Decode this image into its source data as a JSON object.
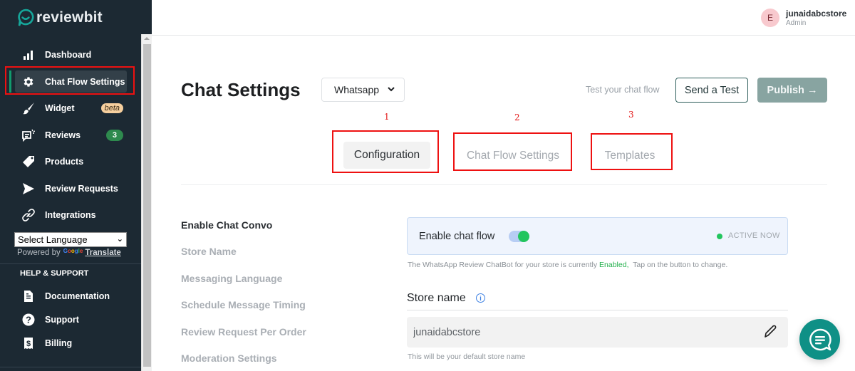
{
  "brand": {
    "name": "reviewbit",
    "accent": "#119b6d",
    "logo_color": "#16a79b"
  },
  "sidebar": {
    "items": [
      {
        "label": "Dashboard",
        "icon": "bar-chart-icon"
      },
      {
        "label": "Chat Flow Settings",
        "icon": "gear-icon",
        "active": true
      },
      {
        "label": "Widget",
        "icon": "brush-icon",
        "badge": "beta"
      },
      {
        "label": "Reviews",
        "icon": "reviews-icon",
        "badge": "3"
      },
      {
        "label": "Products",
        "icon": "tag-icon"
      },
      {
        "label": "Review Requests",
        "icon": "send-icon"
      },
      {
        "label": "Integrations",
        "icon": "link-icon"
      }
    ],
    "language_select": {
      "value": "Select Language"
    },
    "powered_by": "Powered by",
    "google": "Google",
    "translate": "Translate",
    "help_title": "HELP & SUPPORT",
    "help_items": [
      {
        "label": "Documentation",
        "icon": "document-icon"
      },
      {
        "label": "Support",
        "icon": "question-icon"
      },
      {
        "label": "Billing",
        "icon": "receipt-dollar-icon"
      }
    ]
  },
  "user": {
    "initial": "E",
    "name": "junaidabcstore",
    "role": "Admin"
  },
  "header": {
    "title": "Chat Settings",
    "channel": "Whatsapp",
    "test_hint": "Test your chat flow",
    "send_test": "Send a Test",
    "publish": "Publish →"
  },
  "tabs": [
    {
      "number": "1",
      "label": "Configuration",
      "active": true
    },
    {
      "number": "2",
      "label": "Chat Flow Settings",
      "active": false
    },
    {
      "number": "3",
      "label": "Templates",
      "active": false
    }
  ],
  "sections": [
    "Enable Chat Convo",
    "Store Name",
    "Messaging Language",
    "Schedule Message Timing",
    "Review Request Per Order",
    "Moderation Settings"
  ],
  "chat_flow": {
    "label": "Enable chat flow",
    "enabled": true,
    "status": "ACTIVE NOW",
    "help_prefix": "The WhatsApp Review ChatBot for your store is currently ",
    "help_status": "Enabled,",
    "help_suffix": "  Tap on the button to change."
  },
  "store_name": {
    "label": "Store name",
    "value": "junaidabcstore",
    "help": "This will be your default store name"
  }
}
